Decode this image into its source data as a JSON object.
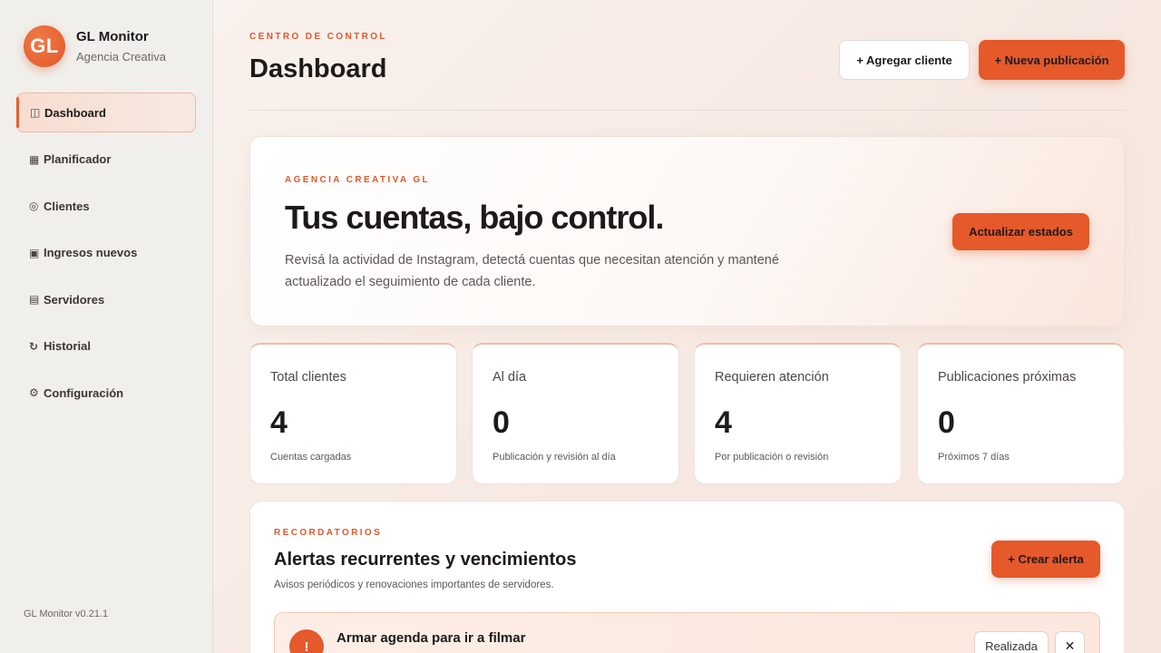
{
  "brand": {
    "logo_text": "GL",
    "name": "GL Monitor",
    "subtitle": "Agencia Creativa"
  },
  "sidebar": {
    "items": [
      {
        "icon": "◫",
        "label": "Dashboard",
        "active": true
      },
      {
        "icon": "▦",
        "label": "Planificador"
      },
      {
        "icon": "◎",
        "label": "Clientes"
      },
      {
        "icon": "▣",
        "label": "Ingresos nuevos"
      },
      {
        "icon": "▤",
        "label": "Servidores"
      },
      {
        "icon": "↻",
        "label": "Historial"
      },
      {
        "icon": "⚙",
        "label": "Configuración"
      }
    ],
    "version": "GL Monitor v0.21.1"
  },
  "header": {
    "eyebrow": "CENTRO DE CONTROL",
    "title": "Dashboard",
    "add_client_label": "+ Agregar cliente",
    "new_post_label": "+ Nueva publicación"
  },
  "hero": {
    "eyebrow": "AGENCIA CREATIVA GL",
    "title": "Tus cuentas, bajo control.",
    "description": "Revisá la actividad de Instagram, detectá cuentas que necesitan atención y mantené actualizado el seguimiento de cada cliente.",
    "refresh_label": "Actualizar estados"
  },
  "stats": [
    {
      "label": "Total clientes",
      "value": "4",
      "sub": "Cuentas cargadas"
    },
    {
      "label": "Al día",
      "value": "0",
      "sub": "Publicación y revisión al día"
    },
    {
      "label": "Requieren atención",
      "value": "4",
      "sub": "Por publicación o revisión"
    },
    {
      "label": "Publicaciones próximas",
      "value": "0",
      "sub": "Próximos 7 días"
    }
  ],
  "reminders": {
    "eyebrow": "RECORDATORIOS",
    "title": "Alertas recurrentes y vencimientos",
    "description": "Avisos periódicos y renovaciones importantes de servidores.",
    "create_label": "+ Crear alerta",
    "alerts": [
      {
        "icon": "!",
        "title": "Armar agenda para ir a filmar",
        "done_label": "Realizada",
        "close_label": "✕"
      }
    ]
  },
  "colors": {
    "accent": "#e5592b",
    "sidebar_bg": "#f1efec"
  }
}
